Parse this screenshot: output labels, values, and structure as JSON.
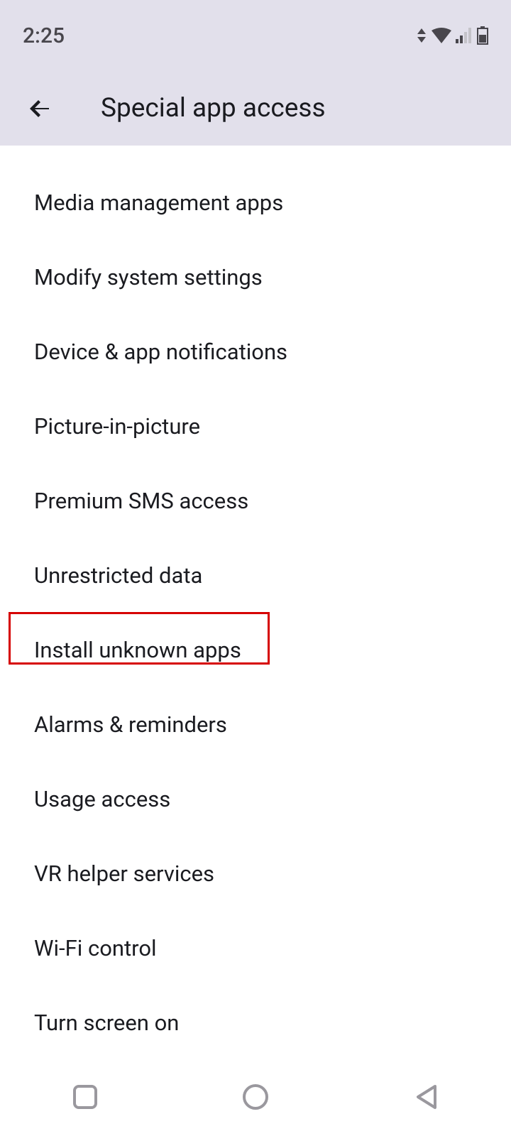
{
  "status": {
    "time": "2:25"
  },
  "header": {
    "title": "Special app access"
  },
  "items": [
    {
      "label": "Media management apps"
    },
    {
      "label": "Modify system settings"
    },
    {
      "label": "Device & app notifications"
    },
    {
      "label": "Picture-in-picture"
    },
    {
      "label": "Premium SMS access"
    },
    {
      "label": "Unrestricted data"
    },
    {
      "label": "Install unknown apps"
    },
    {
      "label": "Alarms & reminders"
    },
    {
      "label": "Usage access"
    },
    {
      "label": "VR helper services"
    },
    {
      "label": "Wi-Fi control"
    },
    {
      "label": "Turn screen on"
    }
  ]
}
